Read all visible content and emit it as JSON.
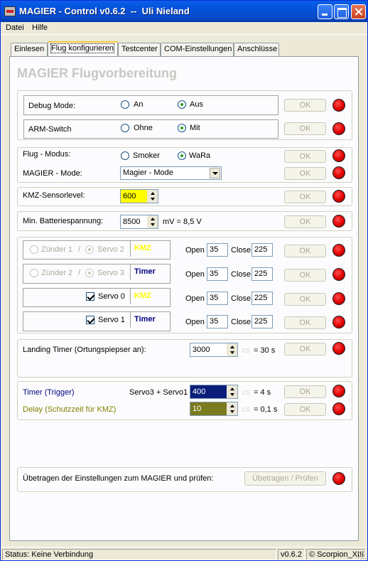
{
  "window": {
    "title": "MAGIER - Control v0.6.2  --  Uli Nieland"
  },
  "menu": {
    "items": [
      "Datei",
      "Hilfe"
    ]
  },
  "tabs": [
    "Einlesen",
    "Flug konfigurieren",
    "Testcenter",
    "COM-Einstellungen",
    "Anschlüsse"
  ],
  "heading": "MAGIER Flugvorbereitung",
  "debug": {
    "label": "Debug Mode:",
    "opt_on": "An",
    "opt_off": "Aus",
    "selected": "Aus",
    "ok": "OK"
  },
  "arm": {
    "label": "ARM-Switch",
    "opt_without": "Ohne",
    "opt_with": "Mit",
    "selected": "Mit",
    "ok": "OK"
  },
  "flight": {
    "label": "Flug - Modus:",
    "opt_smoker": "Smoker",
    "opt_wara": "WaRa",
    "selected": "WaRa",
    "ok": "OK"
  },
  "magier_mode": {
    "label": "MAGIER - Mode:",
    "value": "Magier - Mode",
    "ok": "OK"
  },
  "kmz": {
    "label": "KMZ-Sensorlevel:",
    "value": "600",
    "ok": "OK"
  },
  "battery": {
    "label": "Min. Batteriespannung:",
    "value": "8500",
    "unit": "mV = 8,5 V",
    "ok": "OK"
  },
  "servo_rows": [
    {
      "opt_a": "Zünder 1",
      "sep": "/",
      "opt_b": "Servo 2",
      "tag": "KMZ",
      "open_label": "Open",
      "open": "35",
      "close_label": "Close",
      "close": "225",
      "ok": "OK"
    },
    {
      "opt_a": "Zünder 2",
      "sep": "/",
      "opt_b": "Servo 3",
      "tag": "Timer",
      "open_label": "Open",
      "open": "35",
      "close_label": "Close",
      "close": "225",
      "ok": "OK"
    },
    {
      "check": "Servo 0",
      "tag": "KMZ",
      "open_label": "Open",
      "open": "35",
      "close_label": "Close",
      "close": "225",
      "ok": "OK"
    },
    {
      "check": "Servo 1",
      "tag": "Timer",
      "open_label": "Open",
      "open": "35",
      "close_label": "Close",
      "close": "225",
      "ok": "OK"
    }
  ],
  "landing": {
    "label": "Landing Timer (Ortungspiepser an):",
    "value": "3000",
    "unit": "cs",
    "result": "= 30 s",
    "ok": "OK"
  },
  "timer": {
    "label": "Timer (Trigger)",
    "servos": "Servo3 + Servo1",
    "value": "400",
    "unit": "cs",
    "result": "= 4 s",
    "ok": "OK"
  },
  "delay": {
    "label": "Delay (Schutzzeit für KMZ)",
    "value": "10",
    "unit": "cs",
    "result": "= 0,1 s",
    "ok": "OK"
  },
  "transfer": {
    "label": "Übetragen der Einstellungen zum MAGIER und prüfen:",
    "button": "Übetragen / Prüfen"
  },
  "status": {
    "text": "Status: Keine Verbindung",
    "version": "v0.6.2",
    "author": "© Scorpion_XIII"
  },
  "colors": {
    "led": "#e00000",
    "kmz_tag": "#ffff00",
    "timer_tag": "#000080",
    "timer_field": "#0a1e7a",
    "delay_field": "#7a7a1e",
    "kmz_field": "#ffff00"
  }
}
